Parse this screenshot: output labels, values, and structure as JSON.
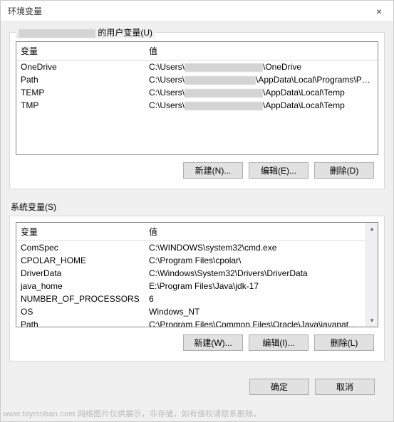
{
  "titlebar": {
    "title": "环境变量",
    "close": "×"
  },
  "user_section": {
    "label_suffix": " 的用户变量(U)",
    "columns": {
      "name": "变量",
      "value": "值"
    },
    "rows": [
      {
        "name": "OneDrive",
        "prefix": "C:\\Users\\",
        "suffix": "\\OneDrive"
      },
      {
        "name": "Path",
        "prefix": "C:\\Users\\",
        "suffix": "\\AppData\\Local\\Programs\\Pyth..."
      },
      {
        "name": "TEMP",
        "prefix": "C:\\Users\\",
        "suffix": "\\AppData\\Local\\Temp"
      },
      {
        "name": "TMP",
        "prefix": "C:\\Users\\",
        "suffix": "\\AppData\\Local\\Temp"
      }
    ],
    "buttons": {
      "new": "新建(N)...",
      "edit": "编辑(E)...",
      "delete": "删除(D)"
    }
  },
  "system_section": {
    "label": "系统变量(S)",
    "columns": {
      "name": "变量",
      "value": "值"
    },
    "rows": [
      {
        "name": "ComSpec",
        "value": "C:\\WINDOWS\\system32\\cmd.exe"
      },
      {
        "name": "CPOLAR_HOME",
        "value": "C:\\Program Files\\cpolar\\"
      },
      {
        "name": "DriverData",
        "value": "C:\\Windows\\System32\\Drivers\\DriverData"
      },
      {
        "name": "java_home",
        "value": "E:\\Program Files\\Java\\jdk-17"
      },
      {
        "name": "NUMBER_OF_PROCESSORS",
        "value": "6"
      },
      {
        "name": "OS",
        "value": "Windows_NT"
      },
      {
        "name": "Path",
        "value": "C:\\Program Files\\Common Files\\Oracle\\Java\\javapath;E:\\Prog..."
      }
    ],
    "buttons": {
      "new": "新建(W)...",
      "edit": "编辑(I)...",
      "delete": "删除(L)"
    }
  },
  "dialog": {
    "ok": "确定",
    "cancel": "取消"
  },
  "watermark": "www.toymoban.com  网络图片仅供展示，非存储，如有侵权请联系删除。",
  "scrollbar": {
    "up": "▴",
    "down": "▾"
  }
}
